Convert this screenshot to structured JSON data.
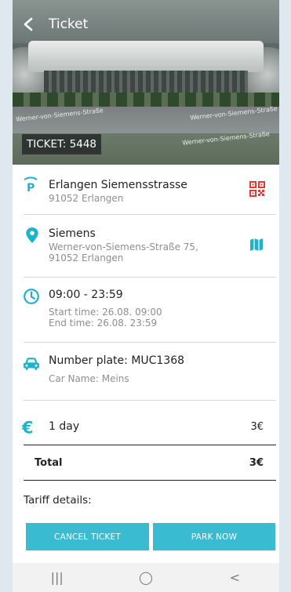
{
  "header": {
    "title": "Ticket",
    "ticket_label": "TICKET: 5448",
    "street_labels": [
      "Werner-von-Siemens-Straße",
      "Werner-von-Siemens-Straße",
      "Werner-von-Siemens-Straße"
    ]
  },
  "parking": {
    "name": "Erlangen Siemensstrasse",
    "city": "91052 Erlangen",
    "icon": "parking-p-icon",
    "action_icon": "qr-code-icon"
  },
  "location": {
    "name": "Siemens",
    "address_line1": "Werner-von-Siemens-Straße 75,",
    "address_line2": "91052 Erlangen",
    "icon": "location-pin-icon",
    "action_icon": "map-icon"
  },
  "time": {
    "range": "09:00 - 23:59",
    "start": "Start time: 26.08. 09:00",
    "end": "End time: 26.08. 23:59",
    "icon": "clock-icon"
  },
  "vehicle": {
    "plate": "Number plate: MUC1368",
    "car_name": "Car Name: Meins",
    "icon": "car-icon"
  },
  "tariff": {
    "duration": "1 day",
    "price": "3€",
    "total_label": "Total",
    "total_value": "3€",
    "details_label": "Tariff details:",
    "icon": "euro-icon"
  },
  "buttons": {
    "cancel": "CANCEL TICKET",
    "park": "PARK NOW"
  },
  "navbar": {
    "recent": "|||",
    "home": "◯",
    "back": "<"
  },
  "colors": {
    "accent": "#1fb3c9",
    "button": "#39bcd1",
    "qr": "#e53935",
    "background": "#dfe8ee"
  }
}
